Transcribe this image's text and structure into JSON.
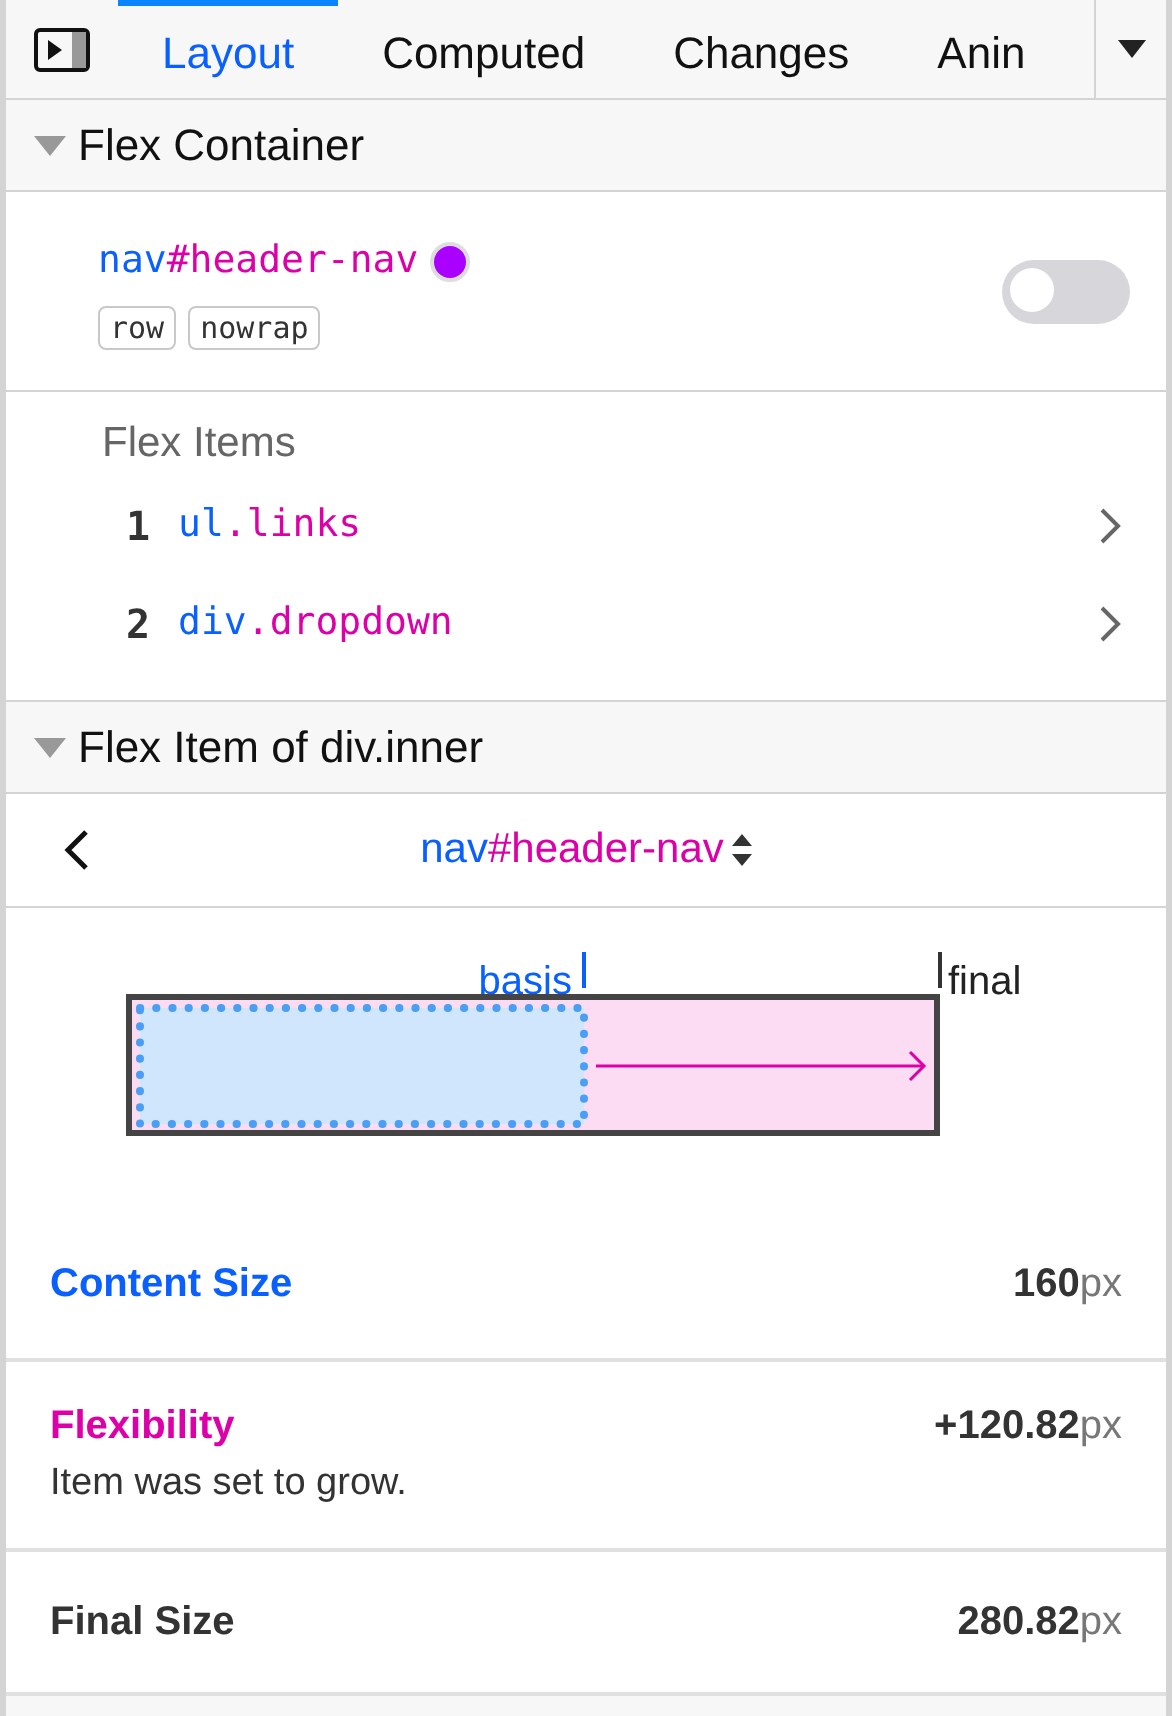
{
  "tabs": [
    {
      "label": "Layout",
      "selected": true
    },
    {
      "label": "Computed",
      "selected": false
    },
    {
      "label": "Changes",
      "selected": false
    },
    {
      "label": "Anin",
      "selected": false
    }
  ],
  "flex_container": {
    "title": "Flex Container",
    "expanded": true,
    "element": {
      "tag": "nav",
      "selector": "#header-nav"
    },
    "badges": [
      "row",
      "nowrap"
    ],
    "overlay_on": false,
    "items_title": "Flex Items",
    "items": [
      {
        "number": "1",
        "tag": "ul",
        "dot": ".",
        "selector": "links"
      },
      {
        "number": "2",
        "tag": "div",
        "dot": ".",
        "selector": "dropdown"
      }
    ]
  },
  "flex_item": {
    "title": "Flex Item of div.inner",
    "expanded": true,
    "element": {
      "tag": "nav",
      "selector": "#header-nav"
    },
    "diagram": {
      "basis_label": "basis",
      "final_label": "final"
    },
    "sizes": [
      {
        "kind": "content",
        "label": "Content Size",
        "value": "160",
        "unit": "px"
      },
      {
        "kind": "flex",
        "label": "Flexibility",
        "value": "+120.82",
        "unit": "px",
        "note": "Item was set to grow."
      },
      {
        "kind": "final",
        "label": "Final Size",
        "value": "280.82",
        "unit": "px"
      }
    ]
  }
}
